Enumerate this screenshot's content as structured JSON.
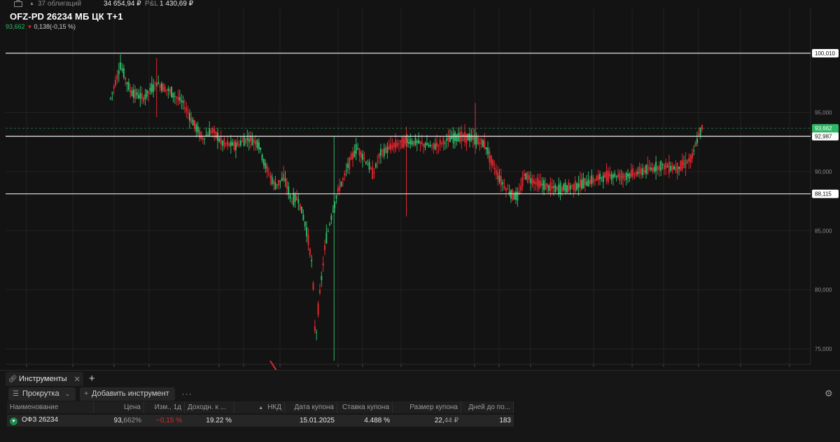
{
  "portfolio": {
    "count_label": "37 облигаций",
    "value": "34 654,94 ₽",
    "pl_label": "P&L",
    "pl_value": "1 430,69 ₽"
  },
  "instrument": {
    "ticker": "OFZ-PD 26234 МБ ЦК Т+1",
    "last": "93,662",
    "change": "0,138(-0,15 %)"
  },
  "chart_data": {
    "type": "candlestick",
    "y_axis": {
      "min": 73.5,
      "max": 103,
      "ticks": [
        75000,
        80000,
        85000,
        90000,
        95000
      ],
      "tick_labels": [
        "75,000",
        "80,000",
        "85,000",
        "90,000",
        "95,000"
      ]
    },
    "levels": [
      {
        "value": 100.01,
        "label": "100,010"
      },
      {
        "value": 92.987,
        "label": "92,987"
      },
      {
        "value": 88.115,
        "label": "88,115"
      }
    ],
    "last_price": {
      "value": 93.662,
      "label": "93,662"
    },
    "colors": {
      "up": "#2fb866",
      "down": "#e0272f",
      "level": "#e6e6e6",
      "last": "#2fb866"
    },
    "path": [
      [
        0,
        96.2
      ],
      [
        0.015,
        99.0
      ],
      [
        0.03,
        96.8
      ],
      [
        0.05,
        96.2
      ],
      [
        0.07,
        97.5
      ],
      [
        0.09,
        96.8
      ],
      [
        0.11,
        95.8
      ],
      [
        0.125,
        94.2
      ],
      [
        0.14,
        92.8
      ],
      [
        0.155,
        93.5
      ],
      [
        0.17,
        92.4
      ],
      [
        0.19,
        92.2
      ],
      [
        0.21,
        92.8
      ],
      [
        0.225,
        92.4
      ],
      [
        0.235,
        90.5
      ],
      [
        0.25,
        88.8
      ],
      [
        0.265,
        89.5
      ],
      [
        0.275,
        87.5
      ],
      [
        0.285,
        87.8
      ],
      [
        0.295,
        85.8
      ],
      [
        0.3,
        84.5
      ],
      [
        0.307,
        82.0
      ],
      [
        0.312,
        75.2
      ],
      [
        0.315,
        78.0
      ],
      [
        0.32,
        80.5
      ],
      [
        0.327,
        84.0
      ],
      [
        0.335,
        86.0
      ],
      [
        0.345,
        88.2
      ],
      [
        0.355,
        89.5
      ],
      [
        0.365,
        91.0
      ],
      [
        0.375,
        92.0
      ],
      [
        0.385,
        91.2
      ],
      [
        0.4,
        89.8
      ],
      [
        0.41,
        91.5
      ],
      [
        0.43,
        92.2
      ],
      [
        0.45,
        92.6
      ],
      [
        0.47,
        92.4
      ],
      [
        0.49,
        92.1
      ],
      [
        0.51,
        92.6
      ],
      [
        0.53,
        93.0
      ],
      [
        0.55,
        92.8
      ],
      [
        0.57,
        92.3
      ],
      [
        0.58,
        90.8
      ],
      [
        0.59,
        89.6
      ],
      [
        0.6,
        88.7
      ],
      [
        0.61,
        88.1
      ],
      [
        0.62,
        87.8
      ],
      [
        0.63,
        89.8
      ],
      [
        0.64,
        89.3
      ],
      [
        0.66,
        88.8
      ],
      [
        0.68,
        88.5
      ],
      [
        0.7,
        88.7
      ],
      [
        0.72,
        89.0
      ],
      [
        0.74,
        89.4
      ],
      [
        0.76,
        89.7
      ],
      [
        0.78,
        89.6
      ],
      [
        0.8,
        89.9
      ],
      [
        0.82,
        90.2
      ],
      [
        0.84,
        90.5
      ],
      [
        0.86,
        90.3
      ],
      [
        0.875,
        90.7
      ],
      [
        0.885,
        91.2
      ],
      [
        0.893,
        92.8
      ],
      [
        0.9,
        93.66
      ]
    ]
  },
  "panel": {
    "tab_label": "Инструменты",
    "scroll_label": "Прокрутка",
    "add_label": "Добавить инструмент",
    "more": "···",
    "columns": {
      "name": "Наименование",
      "price": "Цена",
      "change": "Изм., 1д",
      "yield": "Доходн. к ...",
      "nkd": "НКД",
      "coupon_date": "Дата купона",
      "coupon_rate": "Ставка купона",
      "coupon_size": "Размер купона",
      "days": "Дней до по..."
    },
    "row": {
      "name": "ОФЗ 26234",
      "price_main": "93,",
      "price_tail": "662%",
      "change": "−0,15 %",
      "yield": "19.22 %",
      "nkd": "",
      "coupon_date": "15.01.2025",
      "coupon_rate": "4.488 %",
      "coupon_size_main": "22,",
      "coupon_size_tail": "44 ₽",
      "days": "183"
    }
  }
}
